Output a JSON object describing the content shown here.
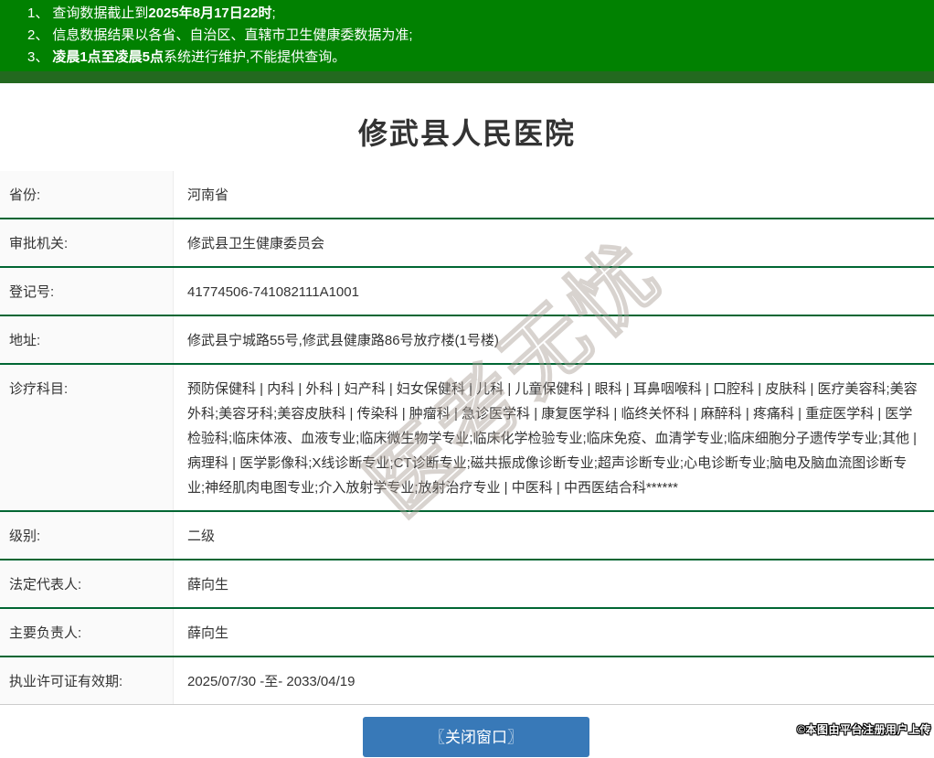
{
  "header": {
    "notices": [
      {
        "num": "1、",
        "segments": [
          {
            "t": "查询数据截止到",
            "b": false
          },
          {
            "t": "2025年8月17日22时",
            "b": true
          },
          {
            "t": ";",
            "b": false
          }
        ]
      },
      {
        "num": "2、",
        "segments": [
          {
            "t": "信息数据结果以各省、自治区、直辖市卫生健康委数据为准;",
            "b": false
          }
        ]
      },
      {
        "num": "3、",
        "segments": [
          {
            "t": "凌晨1点至凌晨5点",
            "b": true
          },
          {
            "t": "系统进行维护,不能提供查询。",
            "b": false
          }
        ]
      }
    ]
  },
  "title": "修武县人民医院",
  "table": {
    "rows": [
      {
        "label": "省份:",
        "value": "河南省"
      },
      {
        "label": "审批机关:",
        "value": "修武县卫生健康委员会"
      },
      {
        "label": "登记号:",
        "value": "41774506-741082111A1001"
      },
      {
        "label": "地址:",
        "value": "修武县宁城路55号,修武县健康路86号放疗楼(1号楼)"
      },
      {
        "label": "诊疗科目:",
        "value": "预防保健科 | 内科 | 外科 | 妇产科 | 妇女保健科 | 儿科 | 儿童保健科 | 眼科 | 耳鼻咽喉科 | 口腔科 | 皮肤科 | 医疗美容科;美容外科;美容牙科;美容皮肤科 | 传染科 | 肿瘤科 | 急诊医学科 | 康复医学科 | 临终关怀科 | 麻醉科 | 疼痛科 | 重症医学科 | 医学检验科;临床体液、血液专业;临床微生物学专业;临床化学检验专业;临床免疫、血清学专业;临床细胞分子遗传学专业;其他 | 病理科 | 医学影像科;X线诊断专业;CT诊断专业;磁共振成像诊断专业;超声诊断专业;心电诊断专业;脑电及脑血流图诊断专业;神经肌肉电图专业;介入放射学专业;放射治疗专业 | 中医科 | 中西医结合科******"
      },
      {
        "label": "级别:",
        "value": "二级"
      },
      {
        "label": "法定代表人:",
        "value": "薛向生"
      },
      {
        "label": "主要负责人:",
        "value": "薛向生"
      },
      {
        "label": "执业许可证有效期:",
        "value": "2025/07/30 -至- 2033/04/19"
      }
    ]
  },
  "button": {
    "label": "〖关闭窗口〗"
  },
  "watermark": {
    "text": "医考无忧"
  },
  "credit": "©本图由平台注册用户上传",
  "colors": {
    "header_green": "#018101",
    "header_strip_green": "#23691f",
    "row_divider_green": "#006633",
    "button_blue": "#3879b8"
  }
}
